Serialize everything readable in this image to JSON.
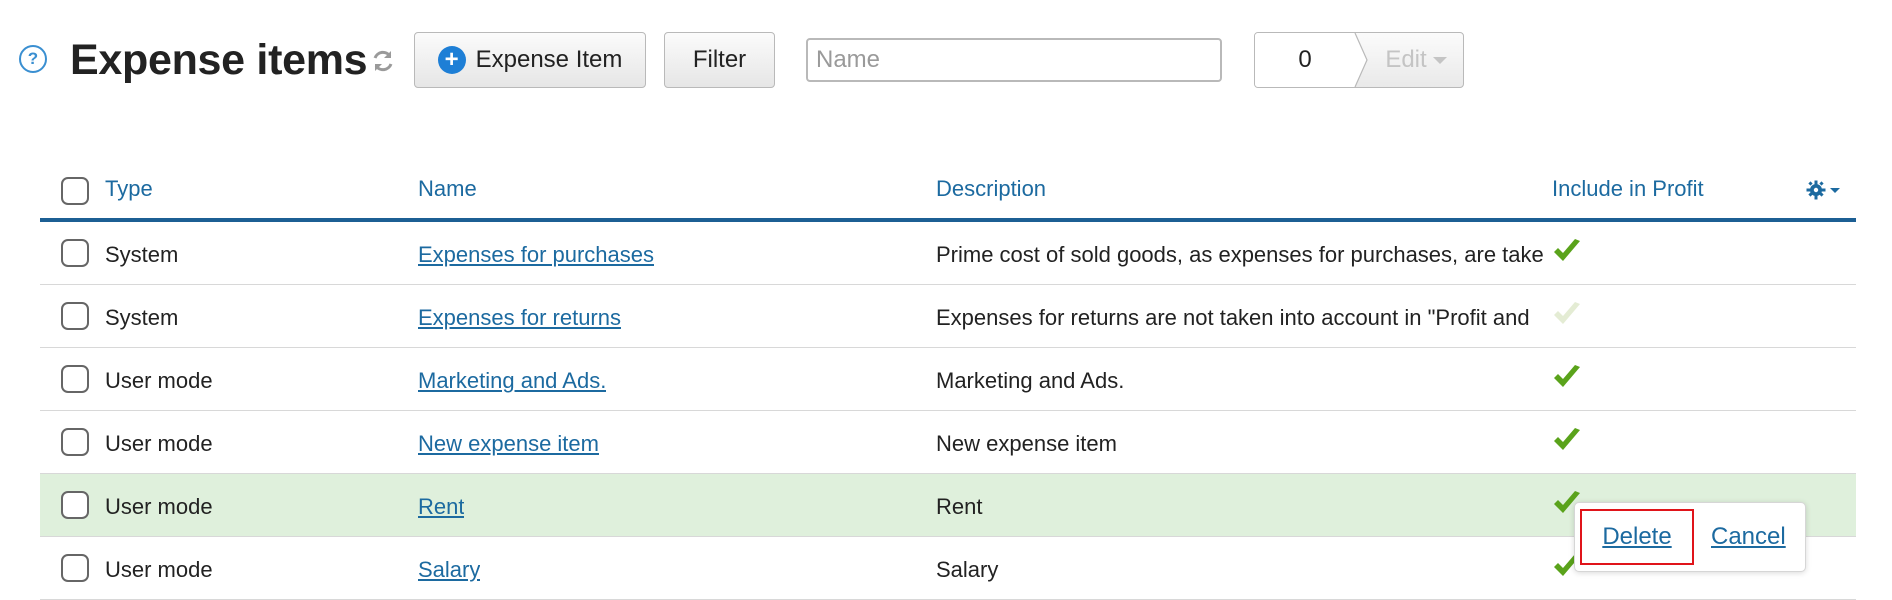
{
  "header": {
    "help_icon": "?",
    "title": "Expense items",
    "add_button_label": "Expense Item",
    "filter_button_label": "Filter",
    "search_placeholder": "Name",
    "selected_count": "0",
    "edit_button_label": "Edit"
  },
  "table": {
    "columns": [
      "Type",
      "Name",
      "Description",
      "Include in Profit"
    ],
    "rows": [
      {
        "type": "System",
        "name": "Expenses for purchases",
        "description": "Prime cost of sold goods, as expenses for purchases, are take",
        "include_in_profit": "enabled"
      },
      {
        "type": "System",
        "name": "Expenses for returns",
        "description": "Expenses for returns are not taken into account in \"Profit and",
        "include_in_profit": "disabled"
      },
      {
        "type": "User mode",
        "name": "Marketing and Ads.",
        "description": "Marketing and Ads.",
        "include_in_profit": "enabled"
      },
      {
        "type": "User mode",
        "name": "New expense item",
        "description": "New expense item",
        "include_in_profit": "enabled"
      },
      {
        "type": "User mode",
        "name": "Rent",
        "description": "Rent",
        "include_in_profit": "enabled",
        "highlighted": true
      },
      {
        "type": "User mode",
        "name": "Salary",
        "description": "Salary",
        "include_in_profit": "enabled"
      }
    ]
  },
  "popup": {
    "delete_label": "Delete",
    "cancel_label": "Cancel"
  },
  "colors": {
    "link": "#1c6aa0",
    "check_enabled": "#5aa31b",
    "check_disabled": "#e4ecd4",
    "selected_row": "#dff0dc",
    "popup_highlight": "#e0141a"
  }
}
